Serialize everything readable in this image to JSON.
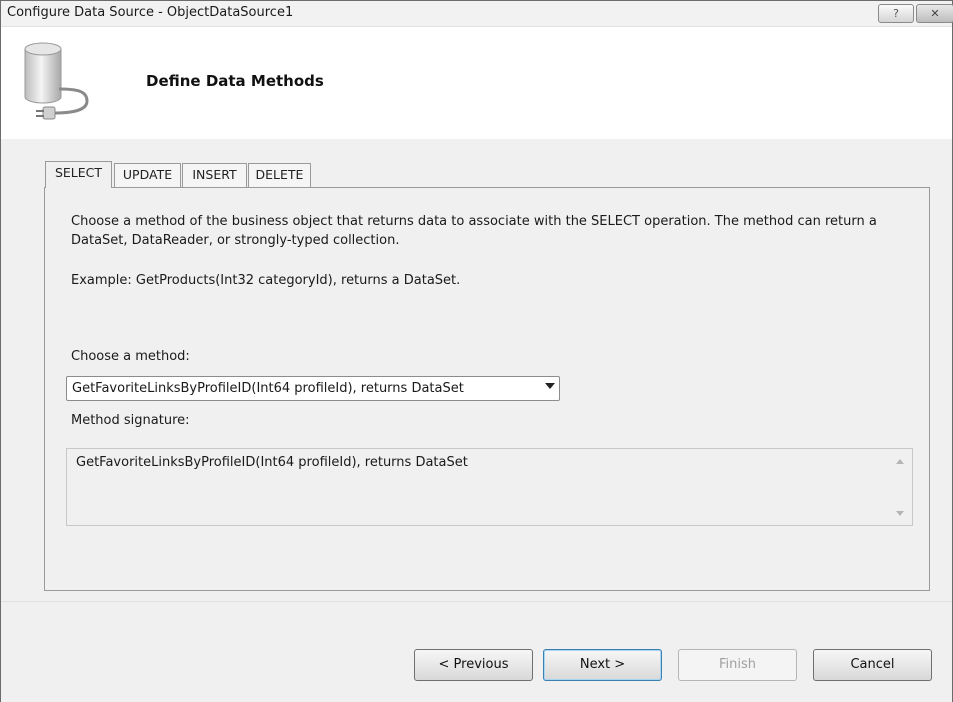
{
  "window": {
    "title": "Configure Data Source - ObjectDataSource1"
  },
  "titlebar": {
    "help_label": "?",
    "close_label": "✕"
  },
  "header": {
    "icon": "database-connector-icon",
    "title": "Define Data Methods"
  },
  "tabs": [
    {
      "label": "SELECT",
      "active": true
    },
    {
      "label": "UPDATE",
      "active": false
    },
    {
      "label": "INSERT",
      "active": false
    },
    {
      "label": "DELETE",
      "active": false
    }
  ],
  "select_tab": {
    "description": "Choose a method of the business object that returns data to associate with the SELECT operation. The method can return a DataSet, DataReader, or strongly-typed collection.",
    "example": "Example: GetProducts(Int32 categoryId), returns a DataSet.",
    "choose_label": "Choose a method:",
    "method_selected": "GetFavoriteLinksByProfileID(Int64 profileId), returns DataSet",
    "signature_label": "Method signature:",
    "signature_value": "GetFavoriteLinksByProfileID(Int64 profileId), returns DataSet"
  },
  "buttons": {
    "previous": "< Previous",
    "next": "Next >",
    "finish": "Finish",
    "cancel": "Cancel"
  }
}
